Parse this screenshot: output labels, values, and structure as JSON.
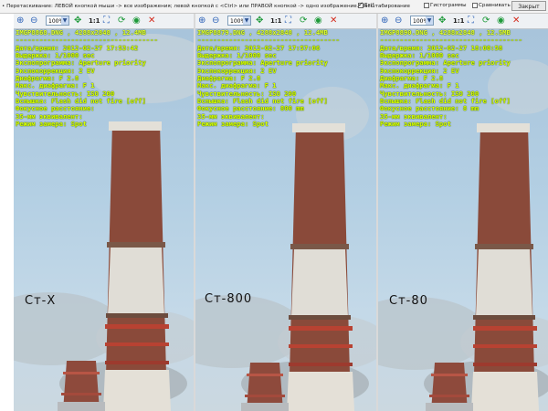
{
  "topbar": {
    "hint": "• Перетаскивание: ЛЕВОЙ кнопкой мыши -> все изображения; левой кнопкой с <Ctrl> или ПРАВОЙ кнопкой -> одно изображение. Масштабирование",
    "options": [
      {
        "label": "Exif",
        "checked": true
      },
      {
        "label": "Гистограммы",
        "checked": false
      },
      {
        "label": "Сравнивать",
        "checked": false
      }
    ],
    "close_label": "Закрыт"
  },
  "toolbar": {
    "zoom_value": "100%",
    "one_to_one": "1:1"
  },
  "panes": [
    {
      "file": "IMGP8868.DNG , 4288x2848 , 12.4MB",
      "datetime": "Дата/время: 2012-02-27 17:53:42",
      "exposure": "Выдержка: 1/1000 sec",
      "program": "Экспопрограмма: Aperture priority",
      "compensation": "Экспокоррекция: 2 EV",
      "aperture": "Диафрагма: F 2.8",
      "max_aperture": "Макс. диафрагма: F 1",
      "iso": "Чувствительность: ISO 200",
      "flash": "Вспышка: Flash did not fire [off]",
      "focus": "Фокусное расстояние:",
      "eq35": "35-мм эквивалент:",
      "metering": "Режим замера: Spot",
      "caption": "Ст-X"
    },
    {
      "file": "IMGP8879.DNG , 4288x2848 , 12.4MB",
      "datetime": "Дата/время: 2012-02-27 17:57:06",
      "exposure": "Выдержка: 1/1000 sec",
      "program": "Экспопрограмма: Aperture priority",
      "compensation": "Экспокоррекция: 2 EV",
      "aperture": "Диафрагма: F 2.8",
      "max_aperture": "Макс. диафрагма: F 1",
      "iso": "Чувствительность: ISO 200",
      "flash": "Вспышка: Flash did not fire [off]",
      "focus": "Фокусное расстояние: 800 mm",
      "eq35": "35-мм эквивалент:",
      "metering": "Режим замера: Spot",
      "caption": "Ст-800"
    },
    {
      "file": "IMGP8890.DNG , 4288x2848 , 12.5MB",
      "datetime": "Дата/время: 2012-02-27 18:00:58",
      "exposure": "Выдержка: 1/1000 sec",
      "program": "Экспопрограмма: Aperture priority",
      "compensation": "Экспокоррекция: 2 EV",
      "aperture": "Диафрагма: F 2.8",
      "max_aperture": "Макс. диафрагма: F 1",
      "iso": "Чувствительность: ISO 200",
      "flash": "Вспышка: Flash did not fire [off]",
      "focus": "Фокусное расстояние: 8 mm",
      "eq35": "35-мм эквивалент:",
      "metering": "Режим замера: Spot",
      "caption": "Ст-80"
    }
  ],
  "colors": {
    "exif_text": "#d8ff00",
    "chimney_red": "#8a4a3a",
    "sky": "#b3cfe3"
  }
}
